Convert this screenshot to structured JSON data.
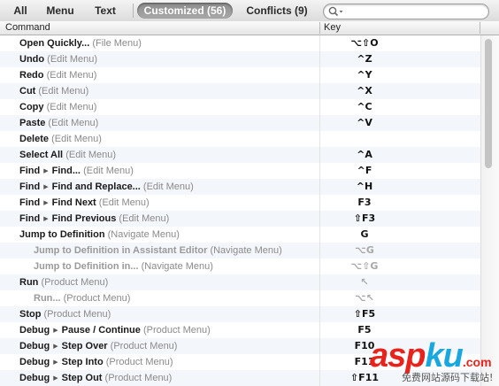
{
  "toolbar": {
    "tabs": [
      "All",
      "Menu",
      "Text",
      "Customized (56)",
      "Conflicts (9)"
    ],
    "selected_tab": "Customized (56)",
    "search": {
      "value": "",
      "placeholder": ""
    }
  },
  "table": {
    "columns": [
      "Command",
      "Key"
    ],
    "rows": [
      {
        "path": [
          "Open Quickly..."
        ],
        "menu": "(File Menu)",
        "key": "⌥⇧O",
        "dim": false,
        "indent": 0
      },
      {
        "path": [
          "Undo"
        ],
        "menu": "(Edit Menu)",
        "key": "^Z",
        "dim": false,
        "indent": 0
      },
      {
        "path": [
          "Redo"
        ],
        "menu": "(Edit Menu)",
        "key": "^Y",
        "dim": false,
        "indent": 0
      },
      {
        "path": [
          "Cut"
        ],
        "menu": "(Edit Menu)",
        "key": "^X",
        "dim": false,
        "indent": 0
      },
      {
        "path": [
          "Copy"
        ],
        "menu": "(Edit Menu)",
        "key": "^C",
        "dim": false,
        "indent": 0
      },
      {
        "path": [
          "Paste"
        ],
        "menu": "(Edit Menu)",
        "key": "^V",
        "dim": false,
        "indent": 0
      },
      {
        "path": [
          "Delete"
        ],
        "menu": "(Edit Menu)",
        "key": "",
        "dim": false,
        "indent": 0
      },
      {
        "path": [
          "Select All"
        ],
        "menu": "(Edit Menu)",
        "key": "^A",
        "dim": false,
        "indent": 0
      },
      {
        "path": [
          "Find",
          "Find..."
        ],
        "menu": "(Edit Menu)",
        "key": "^F",
        "dim": false,
        "indent": 0
      },
      {
        "path": [
          "Find",
          "Find and Replace..."
        ],
        "menu": "(Edit Menu)",
        "key": "^H",
        "dim": false,
        "indent": 0
      },
      {
        "path": [
          "Find",
          "Find Next"
        ],
        "menu": "(Edit Menu)",
        "key": "F3",
        "dim": false,
        "indent": 0
      },
      {
        "path": [
          "Find",
          "Find Previous"
        ],
        "menu": "(Edit Menu)",
        "key": "⇧F3",
        "dim": false,
        "indent": 0
      },
      {
        "path": [
          "Jump to Definition"
        ],
        "menu": "(Navigate Menu)",
        "key": "G",
        "dim": false,
        "indent": 0
      },
      {
        "path": [
          "Jump to Definition in Assistant Editor"
        ],
        "menu": "(Navigate Menu)",
        "key": "⌥G",
        "dim": true,
        "indent": 1
      },
      {
        "path": [
          "Jump to Definition in..."
        ],
        "menu": "(Navigate Menu)",
        "key": "⌥⇧G",
        "dim": true,
        "indent": 1
      },
      {
        "path": [
          "Run"
        ],
        "menu": "(Product Menu)",
        "key": "↖",
        "dim": false,
        "dim_key": true,
        "indent": 0
      },
      {
        "path": [
          "Run..."
        ],
        "menu": "(Product Menu)",
        "key": "⌥↖",
        "dim": true,
        "indent": 1
      },
      {
        "path": [
          "Stop"
        ],
        "menu": "(Product Menu)",
        "key": "⇧F5",
        "dim": false,
        "indent": 0
      },
      {
        "path": [
          "Debug",
          "Pause / Continue"
        ],
        "menu": "(Product Menu)",
        "key": "F5",
        "dim": false,
        "indent": 0
      },
      {
        "path": [
          "Debug",
          "Step Over"
        ],
        "menu": "(Product Menu)",
        "key": "F10",
        "dim": false,
        "indent": 0
      },
      {
        "path": [
          "Debug",
          "Step Into"
        ],
        "menu": "(Product Menu)",
        "key": "F11",
        "dim": false,
        "indent": 0
      },
      {
        "path": [
          "Debug",
          "Step Out"
        ],
        "menu": "(Product Menu)",
        "key": "⇧F11",
        "dim": false,
        "indent": 0
      }
    ]
  },
  "watermark": {
    "brand_a": "asp",
    "brand_b": "ku",
    "brand_c": ".com",
    "subtitle": "免费网站源码下载站!"
  },
  "colors": {
    "selected_tab_bg": "#9a9a9a",
    "row_alt": "#f3f6fa",
    "watermark_red": "#e8231b",
    "watermark_blue": "#19a7e0"
  }
}
